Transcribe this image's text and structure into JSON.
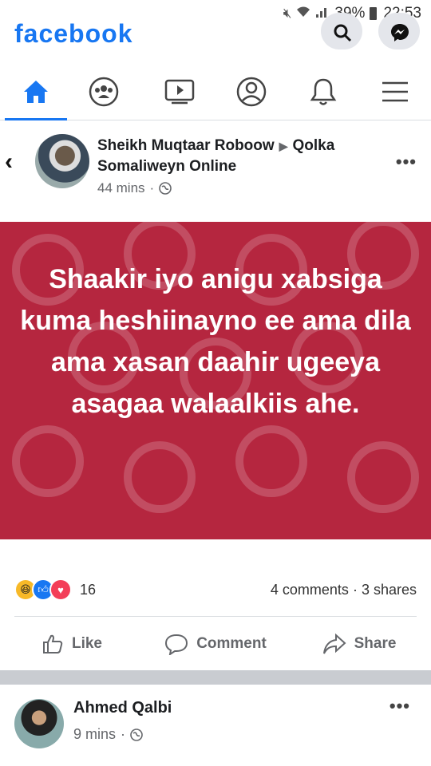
{
  "status_bar": {
    "battery": "39%",
    "time": "22:53",
    "signal_icon": "signal-icon",
    "wifi_icon": "wifi-icon",
    "mute_icon": "mute-icon"
  },
  "header": {
    "brand": "facebook",
    "brand_color": "#1877f2"
  },
  "nav": {
    "tabs": [
      {
        "name": "home",
        "icon": "home-icon",
        "active": true
      },
      {
        "name": "groups",
        "icon": "groups-icon",
        "active": false
      },
      {
        "name": "watch",
        "icon": "watch-icon",
        "active": false
      },
      {
        "name": "profile",
        "icon": "profile-icon",
        "active": false
      },
      {
        "name": "notifications",
        "icon": "bell-icon",
        "active": false
      },
      {
        "name": "menu",
        "icon": "menu-icon",
        "active": false
      }
    ]
  },
  "post": {
    "author": "Sheikh Muqtaar Roboow",
    "target": "Qolka Somaliweyn Online",
    "time": "44 mins",
    "text": "Shaakir iyo anigu xabsiga kuma heshiinayno ee ama dila ama xasan daahir ugeeya asagaa walaalkiis ahe.",
    "background_color": "#b5263f",
    "reaction_count": "16",
    "comments": "4 comments",
    "shares": "3 shares",
    "actions": {
      "like": "Like",
      "comment": "Comment",
      "share": "Share"
    }
  },
  "post2": {
    "author": "Ahmed Qalbi",
    "time": "9 mins"
  }
}
